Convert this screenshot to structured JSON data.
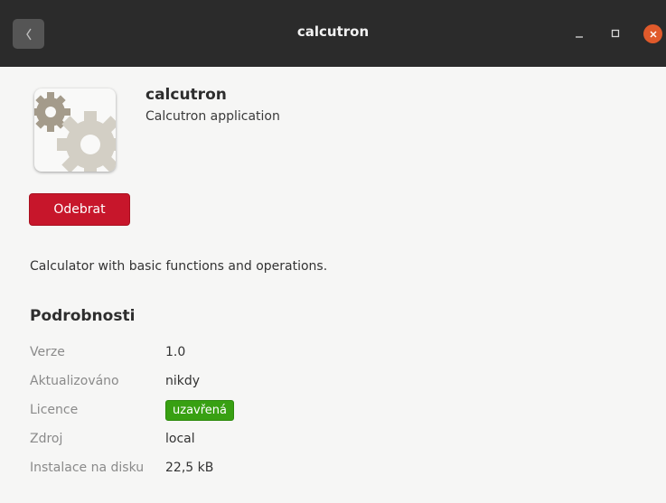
{
  "window": {
    "title": "calcutron"
  },
  "app": {
    "name": "calcutron",
    "summary": "Calcutron application",
    "remove_label": "Odebrat",
    "description": "Calculator with basic functions and operations."
  },
  "details": {
    "heading": "Podrobnosti",
    "rows": [
      {
        "key": "Verze",
        "value": "1.0"
      },
      {
        "key": "Aktualizováno",
        "value": "nikdy"
      },
      {
        "key": "Licence",
        "value": "uzavřená"
      },
      {
        "key": "Zdroj",
        "value": "local"
      },
      {
        "key": "Instalace na disku",
        "value": "22,5 kB"
      }
    ]
  },
  "colors": {
    "titlebar": "#2b2b2b",
    "remove_button": "#c7162b",
    "license_badge": "#38a012",
    "close_button": "#e05a2b"
  },
  "icons": {
    "back": "chevron-left-icon",
    "minimize": "minimize-icon",
    "maximize": "maximize-icon",
    "close": "close-icon",
    "app": "gear-icon"
  }
}
